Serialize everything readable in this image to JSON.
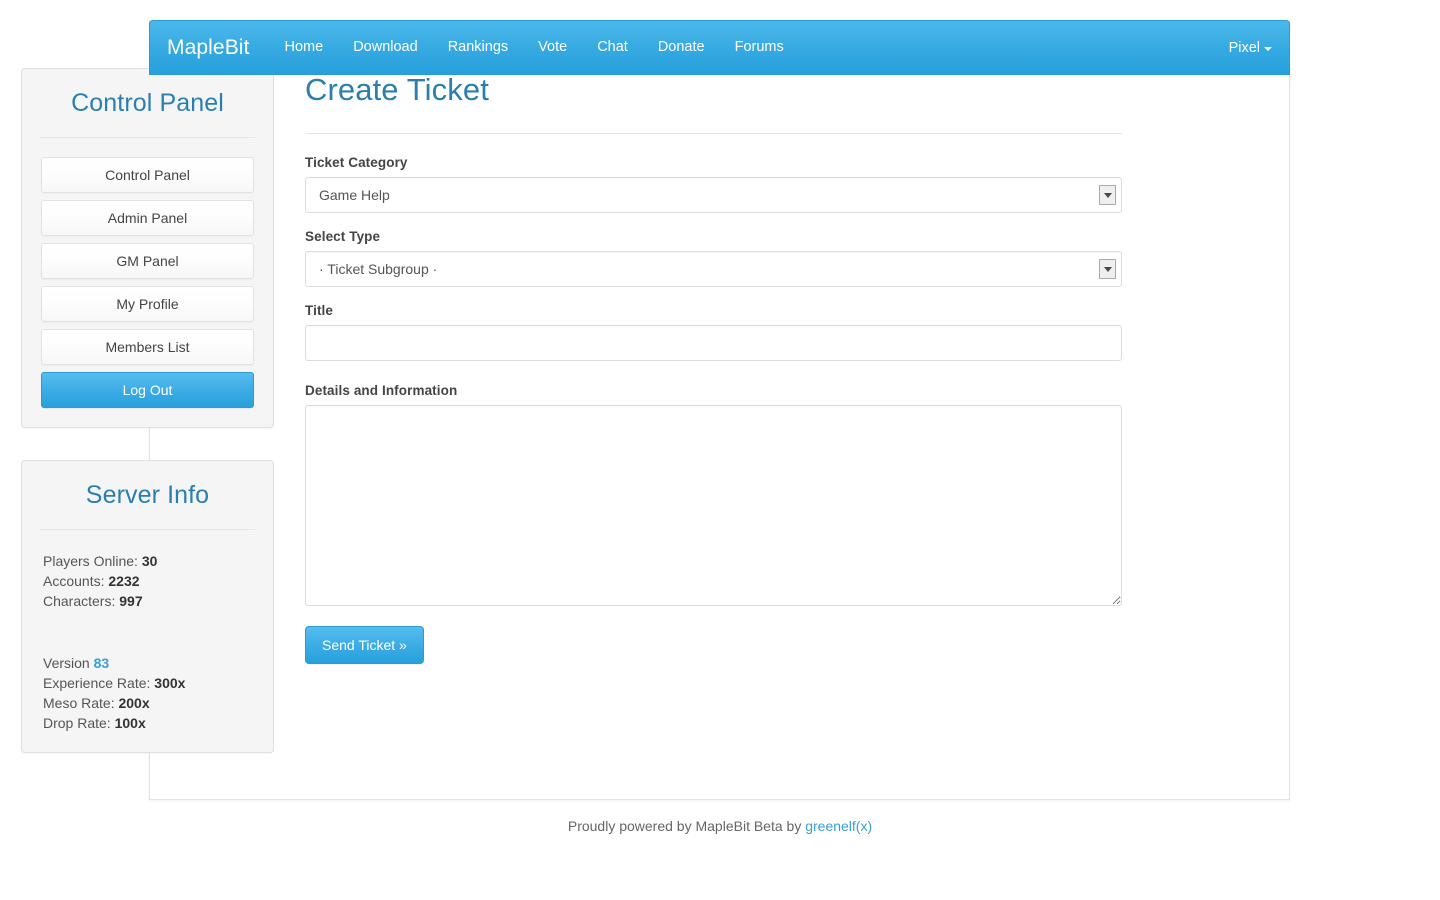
{
  "navbar": {
    "brand": "MapleBit",
    "links": [
      {
        "label": "Home"
      },
      {
        "label": "Download"
      },
      {
        "label": "Rankings"
      },
      {
        "label": "Vote"
      },
      {
        "label": "Chat"
      },
      {
        "label": "Donate"
      },
      {
        "label": "Forums"
      }
    ],
    "user": {
      "label": "Pixel",
      "caret_icon": "caret-down-icon"
    },
    "background_color": "#35a9e1"
  },
  "sidebar": {
    "control_panel": {
      "title": "Control Panel",
      "buttons": [
        {
          "label": "Control Panel",
          "style": "default"
        },
        {
          "label": "Admin Panel",
          "style": "default"
        },
        {
          "label": "GM Panel",
          "style": "default"
        },
        {
          "label": "My Profile",
          "style": "default"
        },
        {
          "label": "Members List",
          "style": "default"
        },
        {
          "label": "Log Out",
          "style": "primary"
        }
      ]
    },
    "server_info": {
      "title": "Server Info",
      "stats": [
        {
          "label": "Players Online:",
          "value": "30"
        },
        {
          "label": "Accounts:",
          "value": "2232"
        },
        {
          "label": "Characters:",
          "value": "997"
        }
      ],
      "rates": [
        {
          "label": "Version",
          "value": "83",
          "accent": true
        },
        {
          "label": "Experience Rate:",
          "value": "300x"
        },
        {
          "label": "Meso Rate:",
          "value": "200x"
        },
        {
          "label": "Drop Rate:",
          "value": "100x"
        }
      ]
    }
  },
  "main": {
    "page_title": "Create Ticket",
    "fields": {
      "category": {
        "label": "Ticket Category",
        "value": "Game Help",
        "options": [
          "Game Help"
        ]
      },
      "type": {
        "label": "Select Type",
        "value": "· Ticket Subgroup ·",
        "options": [
          "· Ticket Subgroup ·"
        ]
      },
      "title": {
        "label": "Title",
        "value": "",
        "placeholder": ""
      },
      "details": {
        "label": "Details and Information",
        "value": "",
        "placeholder": ""
      }
    },
    "submit_label": "Send Ticket »"
  },
  "footer": {
    "text": "Proudly powered by MapleBit Beta by",
    "link": "greenelf(x)"
  },
  "colors": {
    "brand_blue": "#35a9e1",
    "heading_blue": "#2a7fae",
    "link_blue": "#3a9ed6"
  }
}
